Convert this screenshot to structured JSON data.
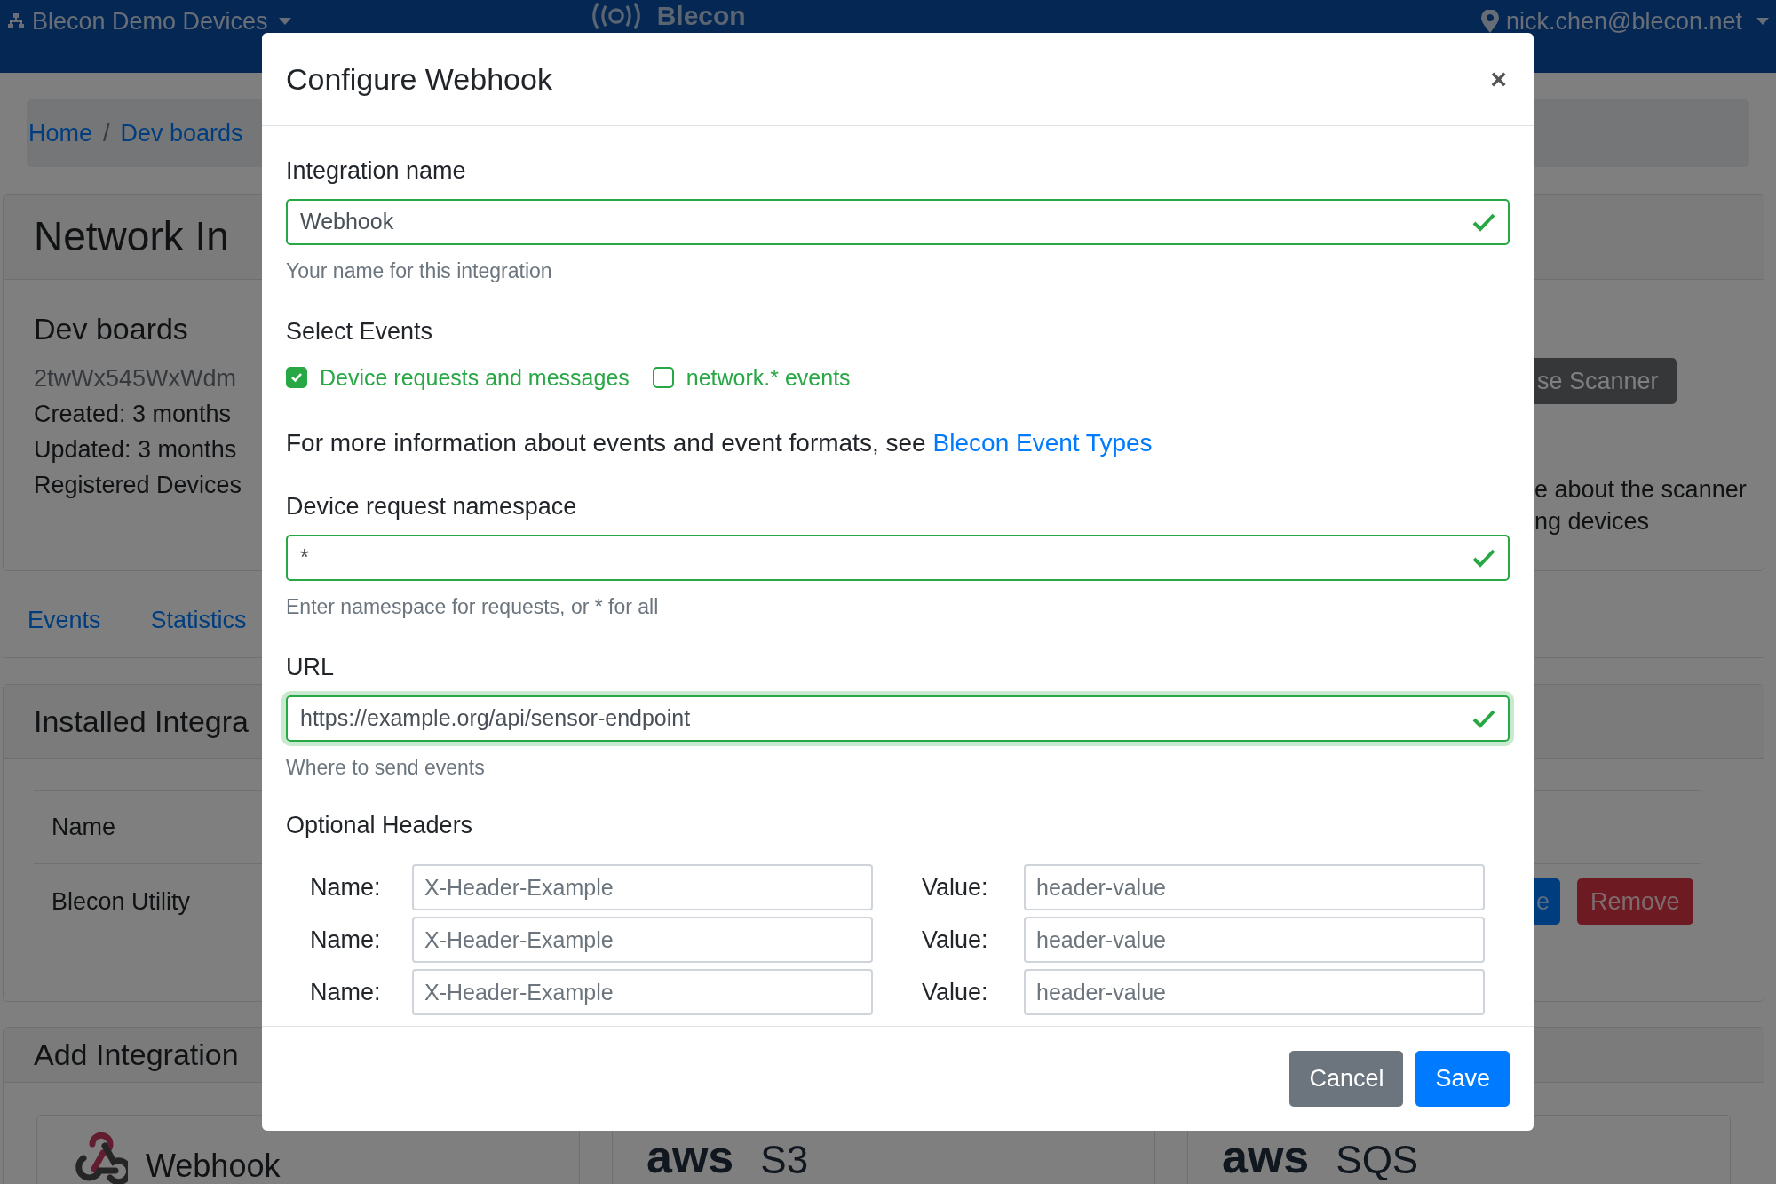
{
  "navbar": {
    "org_menu": "Blecon Demo Devices",
    "logo": "Blecon",
    "user_menu": "nick.chen@blecon.net"
  },
  "breadcrumb": {
    "separator": "/",
    "links": [
      "Home",
      "Dev boards"
    ]
  },
  "page": {
    "title": "Network In",
    "network": {
      "name": "Dev boards",
      "id": "2twWx545WxWdm",
      "lines": [
        "Created: 3 months",
        "Updated: 3 months",
        "Registered Devices"
      ]
    },
    "scanner_button": "se Scanner",
    "scanner_note": [
      "e about the scanner",
      "ng devices"
    ],
    "tabs": [
      "Events",
      "Statistics"
    ],
    "installed": {
      "title": "Installed Integra",
      "column": "Name",
      "row": {
        "name": "Blecon Utility",
        "edit": "e",
        "remove": "Remove"
      }
    },
    "add": {
      "title": "Add Integration",
      "options": [
        {
          "kind": "webhook",
          "label": "Webhook"
        },
        {
          "kind": "aws",
          "brand": "aws",
          "service": "S3"
        },
        {
          "kind": "aws",
          "brand": "aws",
          "service": "SQS"
        }
      ]
    }
  },
  "modal": {
    "title": "Configure Webhook",
    "close": "×",
    "name_field": {
      "label": "Integration name",
      "value": "Webhook",
      "help": "Your name for this integration",
      "valid": true,
      "focused": false
    },
    "events": {
      "label": "Select Events",
      "options": [
        {
          "label": "Device requests and messages",
          "checked": true
        },
        {
          "label": "network.* events",
          "checked": false
        }
      ]
    },
    "info": {
      "text": "For more information about events and event formats, see",
      "link": "Blecon Event Types"
    },
    "namespace_field": {
      "label": "Device request namespace",
      "value": "*",
      "help": "Enter namespace for requests, or * for all",
      "valid": true,
      "focused": false
    },
    "url_field": {
      "label": "URL",
      "value": "https://example.org/api/sensor-endpoint",
      "help": "Where to send events",
      "valid": true,
      "focused": true
    },
    "headers": {
      "label": "Optional Headers",
      "rows": [
        {
          "name_label": "Name:",
          "name_placeholder": "X-Header-Example",
          "value_label": "Value:",
          "value_placeholder": "header-value"
        },
        {
          "name_label": "Name:",
          "name_placeholder": "X-Header-Example",
          "value_label": "Value:",
          "value_placeholder": "header-value"
        },
        {
          "name_label": "Name:",
          "name_placeholder": "X-Header-Example",
          "value_label": "Value:",
          "value_placeholder": "header-value"
        }
      ]
    },
    "buttons": [
      {
        "label": "Cancel",
        "kind": "secondary"
      },
      {
        "label": "Save",
        "kind": "primary"
      }
    ]
  }
}
